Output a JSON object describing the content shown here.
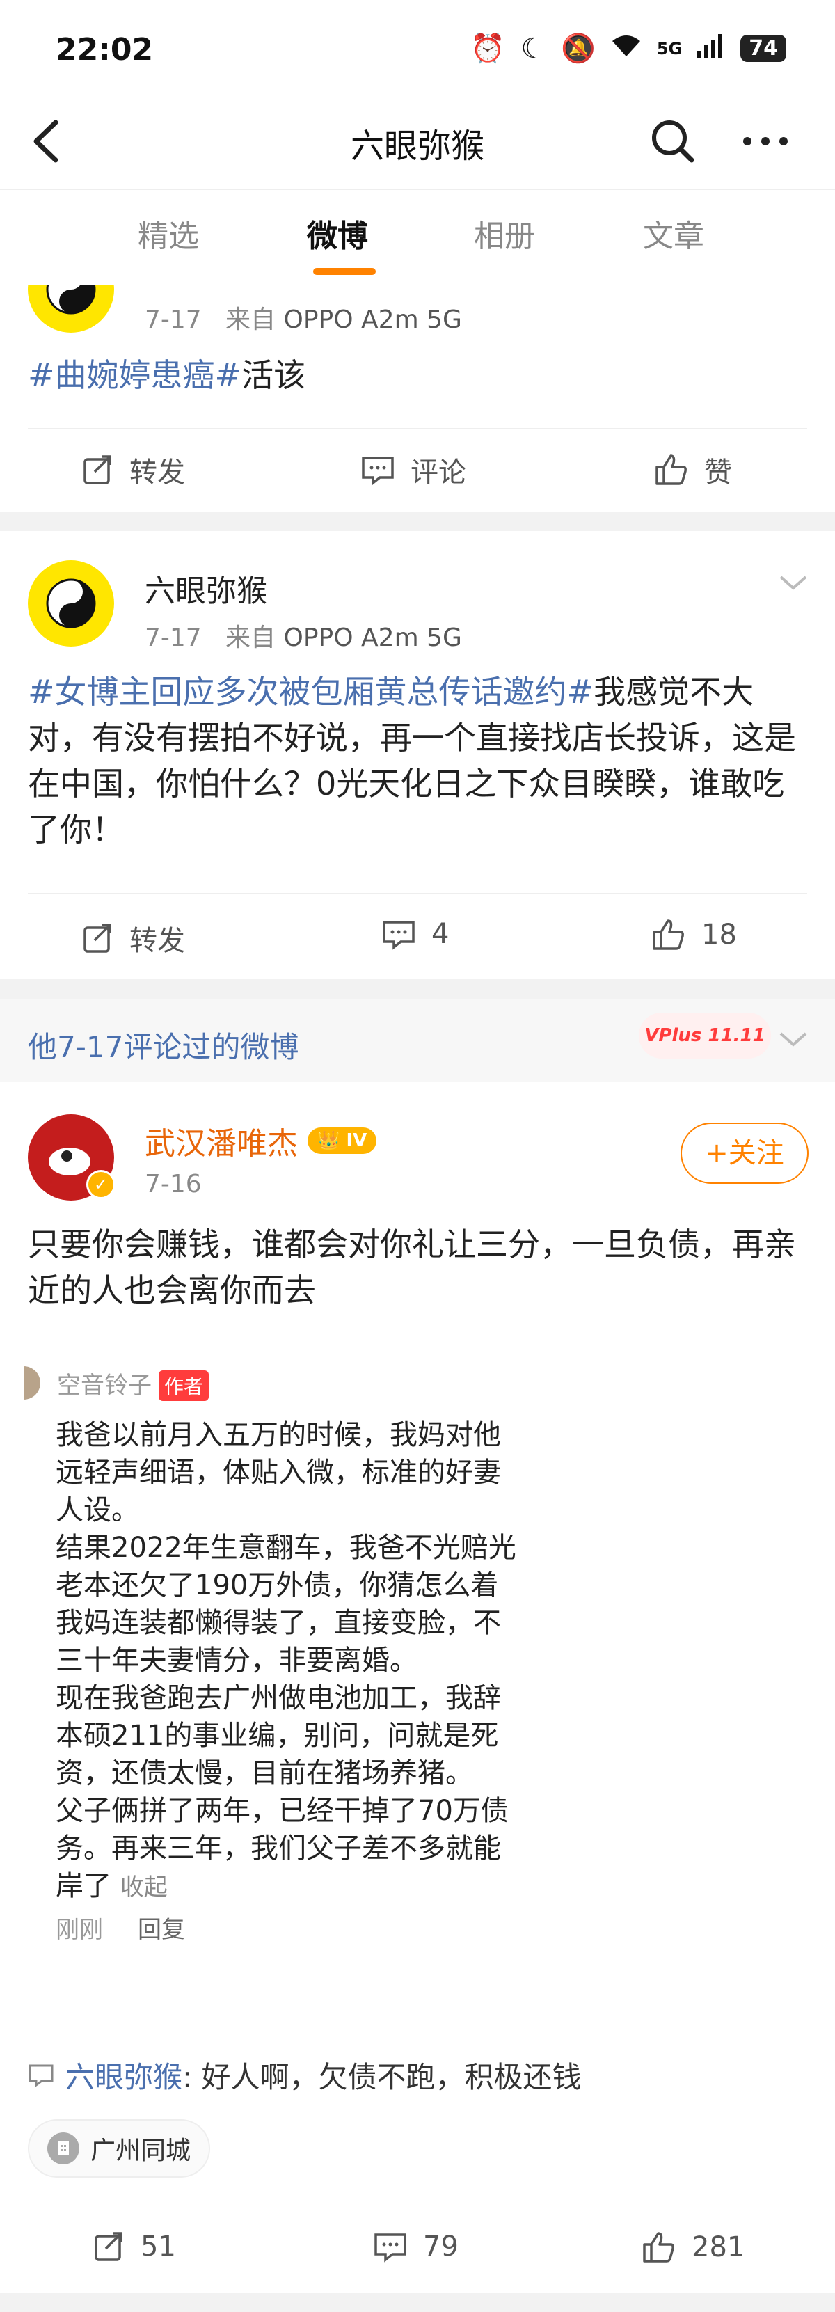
{
  "status_bar": {
    "time": "22:02",
    "battery": "74",
    "network": "5G"
  },
  "header": {
    "title": "六眼弥猴"
  },
  "tabs": [
    {
      "label": "精选"
    },
    {
      "label": "微博",
      "active": true
    },
    {
      "label": "相册"
    },
    {
      "label": "文章"
    }
  ],
  "post1": {
    "date": "7-17",
    "source_prefix": "来自",
    "source": "OPPO A2m 5G",
    "topic": "#曲婉婷患癌#",
    "text": "活该",
    "actions": {
      "repost": "转发",
      "comment": "评论",
      "like": "赞"
    }
  },
  "post2": {
    "author": "六眼弥猴",
    "date": "7-17",
    "source_prefix": "来自",
    "source": "OPPO A2m 5G",
    "topic": "#女博主回应多次被包厢黄总传话邀约#",
    "text": "我感觉不大对，有没有摆拍不好说，再一个直接找店长投诉，这是在中国，你怕什么？0光天化日之下众目睽睽，谁敢吃了你！",
    "actions": {
      "repost": "转发",
      "comment": "4",
      "like": "18"
    }
  },
  "commented_section": {
    "title": "他7-17评论过的微博",
    "badge": "VPlus 11.11"
  },
  "post3": {
    "author": "武汉潘唯杰",
    "level": "IV",
    "date": "7-16",
    "follow_label": "+关注",
    "text": "只要你会赚钱，谁都会对你礼让三分，一旦负债，再亲近的人也会离你而去",
    "quote": {
      "author": "空音铃子",
      "badge": "作者",
      "lines": [
        "我爸以前月入五万的时候，我妈对他",
        "远轻声细语，体贴入微，标准的好妻",
        "人设。",
        "结果2022年生意翻车，我爸不光赔光",
        "老本还欠了190万外债，你猜怎么着",
        "我妈连装都懒得装了，直接变脸，不",
        "三十年夫妻情分，非要离婚。",
        "现在我爸跑去广州做电池加工，我辞",
        "本硕211的事业编，别问，问就是死",
        "资，还债太慢，目前在猪场养猪。",
        "父子俩拼了两年，已经干掉了70万债",
        "务。再来三年，我们父子差不多就能",
        "岸了"
      ],
      "collapse": "收起",
      "time": "刚刚",
      "reply": "回复"
    },
    "reply": {
      "who": "六眼弥猴",
      "sep": ":",
      "text": " 好人啊，欠债不跑，积极还钱"
    },
    "location": "广州同城",
    "actions": {
      "repost": "51",
      "comment": "79",
      "like": "281"
    }
  },
  "colors": {
    "accent": "#ff8200",
    "topic": "#4a6fae",
    "author_orange": "#e8660a"
  }
}
